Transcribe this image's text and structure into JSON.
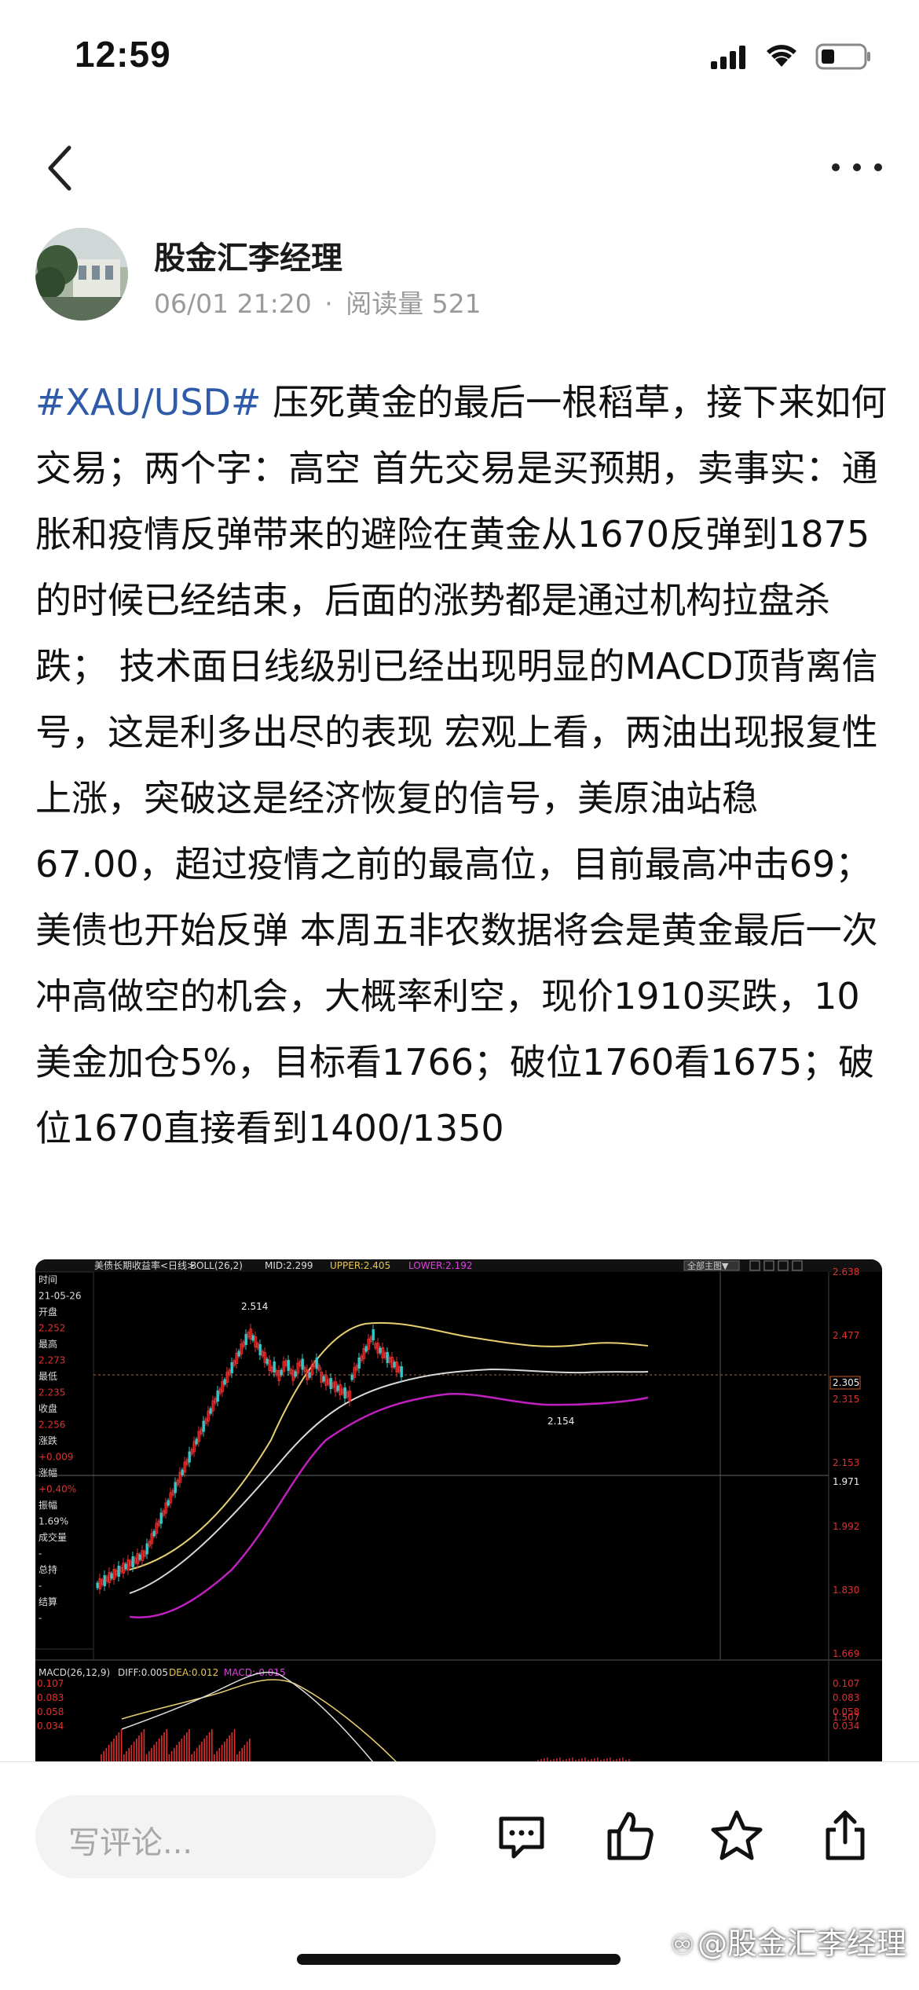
{
  "status_bar": {
    "time": "12:59"
  },
  "author": {
    "name": "股金汇李经理",
    "date": "06/01 21:20",
    "separator": "·",
    "read_label": "阅读量 521"
  },
  "post": {
    "hashtag": "#XAU/USD#",
    "body": " 压死黄金的最后一根稻草，接下来如何交易；两个字：高空 首先交易是买预期，卖事实：通胀和疫情反弹带来的避险在黄金从1670反弹到1875的时候已经结束，后面的涨势都是通过机构拉盘杀跌； 技术面日线级别已经出现明显的MACD顶背离信号，这是利多出尽的表现 宏观上看，两油出现报复性上涨，突破这是经济恢复的信号，美原油站稳67.00，超过疫情之前的最高位，目前最高冲击69；美债也开始反弹 本周五非农数据将会是黄金最后一次冲高做空的机会，大概率利空，现价1910买跌，10美金加仓5%，目标看1766；破位1760看1675；破位1670直接看到1400/1350"
  },
  "chart": {
    "title": "美债长期收益率<日线>",
    "boll": "BOLL(26,2)",
    "mid": "MID:2.299",
    "upper": "UPPER:2.405",
    "lower": "LOWER:2.192",
    "menu": "全部主图▼",
    "info_items": [
      "时间",
      "21-05-26",
      "开盘",
      "2.252",
      "最高",
      "2.273",
      "最低",
      "2.235",
      "收盘",
      "2.256",
      "涨跌",
      "+0.009",
      "涨幅",
      "+0.40%",
      "振幅",
      "1.69%",
      "成交量",
      "-",
      "总持",
      "-",
      "结算",
      "-"
    ],
    "price_ticks": [
      "2.638",
      "2.477",
      "2.315",
      "2.153",
      "1.992",
      "1.830",
      "1.669",
      "1.507"
    ],
    "current_price": "2.305",
    "crosshair_value": "1.971",
    "high_label": "2.514",
    "low_label": "2.154",
    "macd": {
      "title": "MACD(26,12,9)",
      "diff": "DIFF:0.005",
      "dea": "DEA:0.012",
      "macd": "MACD:-0.015",
      "ticks": [
        "0.107",
        "0.083",
        "0.058",
        "0.034"
      ]
    }
  },
  "bottom_bar": {
    "comment_placeholder": "写评论...",
    "watermark": "@股金汇李经理"
  }
}
